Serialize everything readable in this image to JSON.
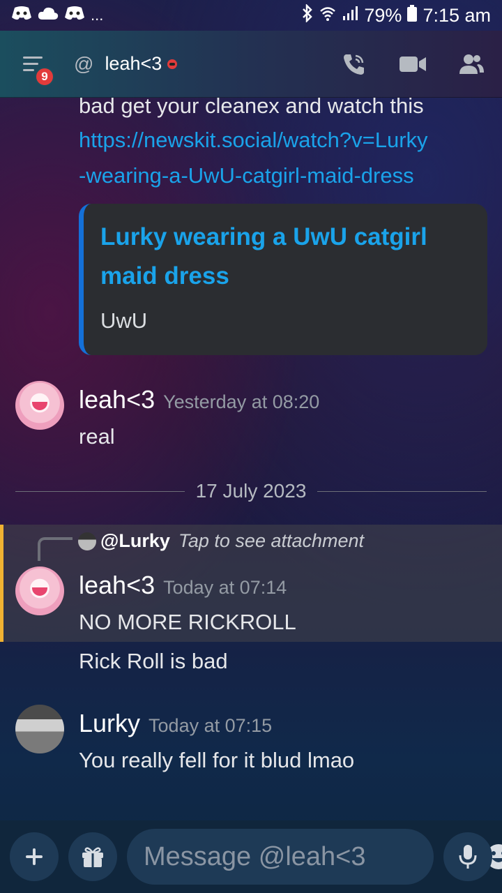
{
  "status_bar": {
    "left_icons": [
      "discord-icon",
      "cloud-icon",
      "discord-icon"
    ],
    "more": "...",
    "battery": "79%",
    "time": "7:15 am"
  },
  "header": {
    "badge_count": "9",
    "title": "leah<3"
  },
  "messages": {
    "continued_text": "bad get your cleanex and watch this",
    "link_line1": "https://newskit.social/watch?v=Lurky",
    "link_line2": "-wearing-a-UwU-catgirl-maid-dress",
    "embed": {
      "title_line1": "Lurky wearing a UwU catgirl",
      "title_line2": "maid dress",
      "description": "UwU"
    },
    "msg1": {
      "author": "leah<3",
      "timestamp": "Yesterday at 08:20",
      "text": "real"
    },
    "divider_date": "17 July 2023",
    "reply": {
      "user": "@Lurky",
      "hint": "Tap to see attachment"
    },
    "msg2": {
      "author": "leah<3",
      "timestamp": "Today at 07:14",
      "text": "NO MORE RICKROLL",
      "followup": "Rick Roll is bad"
    },
    "msg3": {
      "author": "Lurky",
      "timestamp": "Today at 07:15",
      "text": "You really fell for it blud lmao"
    }
  },
  "composer": {
    "placeholder": "Message @leah<3"
  },
  "colors": {
    "link": "#1aa3ea",
    "mention_bar": "#f0b232",
    "badge": "#e23b3b"
  }
}
